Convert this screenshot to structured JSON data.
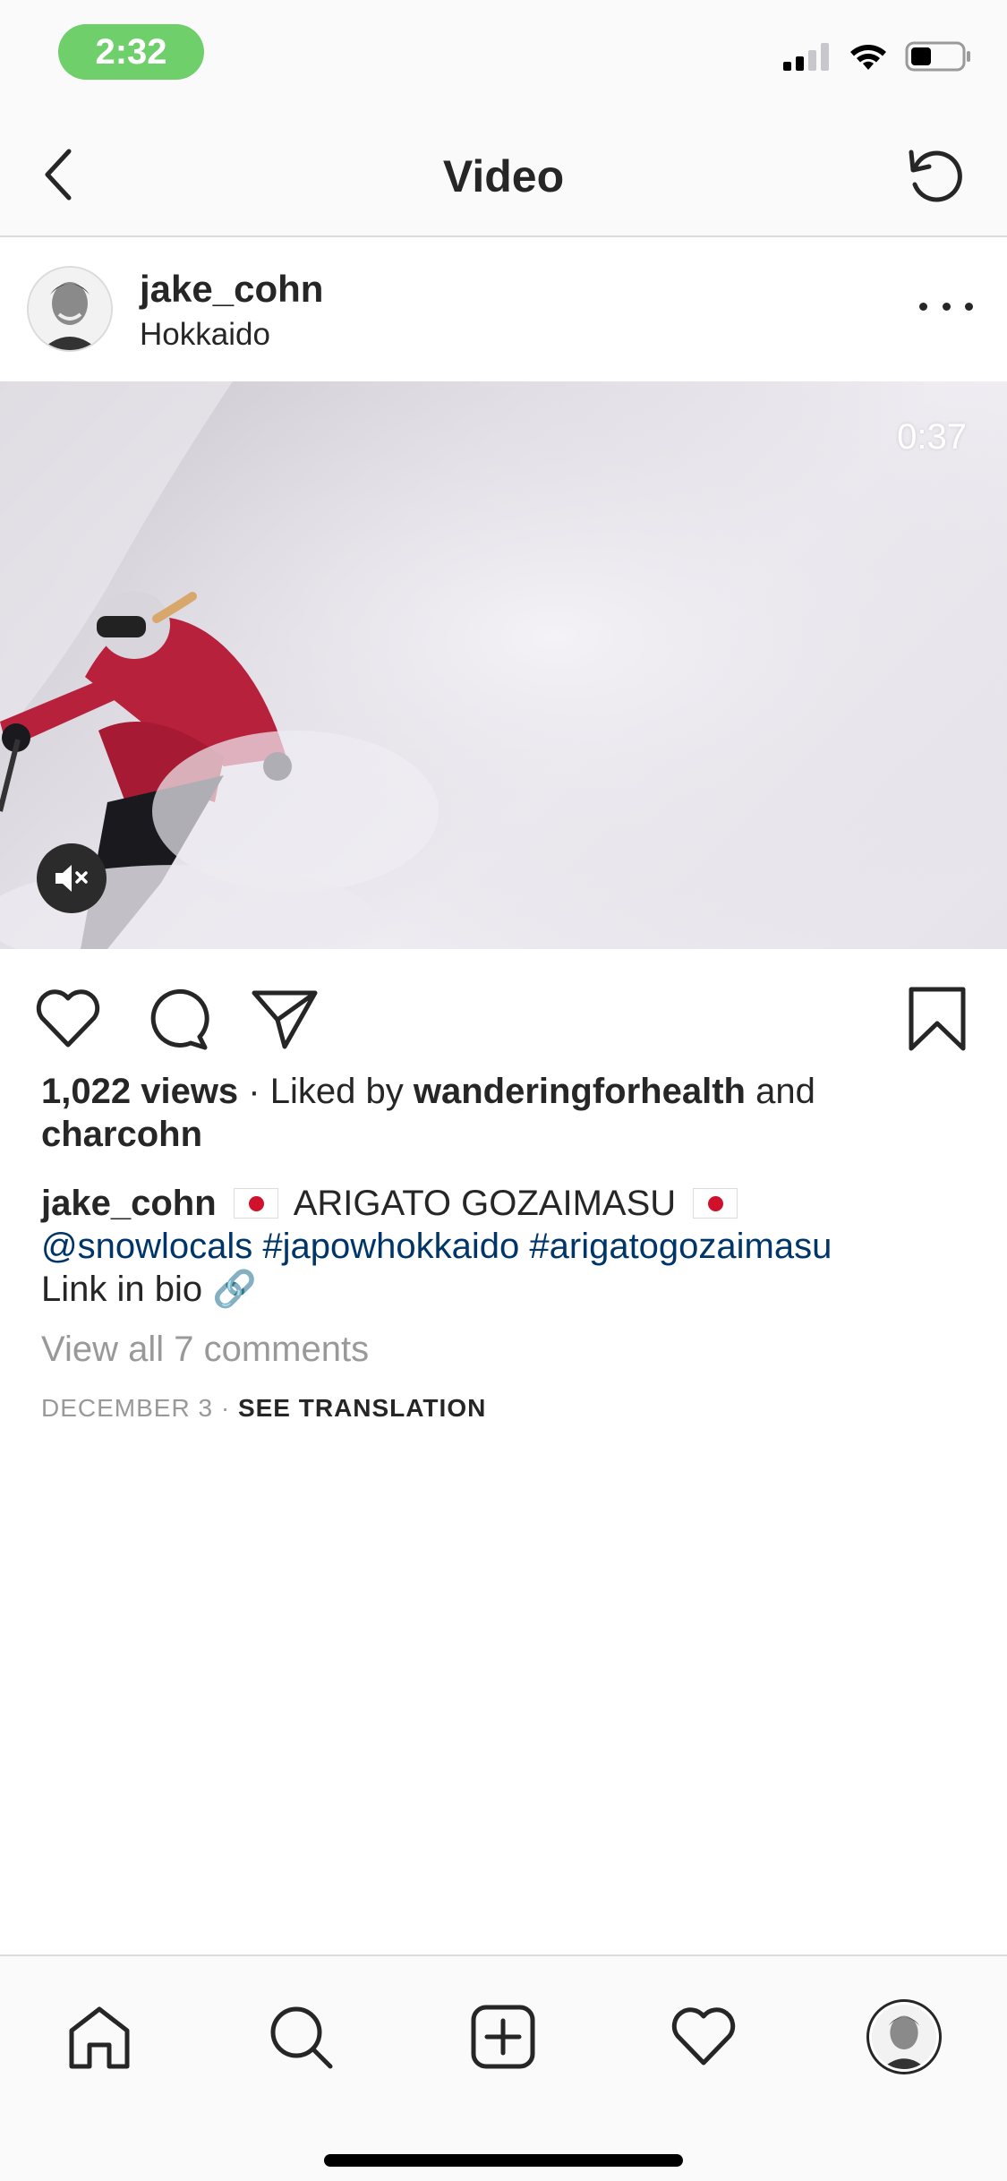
{
  "status_bar": {
    "time": "2:32"
  },
  "nav": {
    "title": "Video"
  },
  "post": {
    "username": "jake_cohn",
    "location": "Hokkaido",
    "video_duration": "0:37",
    "views": "1,022 views",
    "liked_by_prefix": " · Liked by ",
    "liked_by_user1": "wanderingforhealth",
    "liked_by_and": " and",
    "liked_by_user2": "charcohn",
    "caption_user": "jake_cohn",
    "caption_text": " ARIGATO GOZAIMASU ",
    "mention": "@snowlocals",
    "hashtag1": "#japowhokkaido",
    "hashtag2": "#arigatogozaimasu",
    "caption_line3": "Link in bio",
    "link_emoji": "🔗",
    "comments_link": "View all 7 comments",
    "date": "DECEMBER 3",
    "date_sep": " · ",
    "see_translation": "SEE TRANSLATION"
  },
  "icons": {
    "back": "chevron-left-icon",
    "reload": "refresh-icon",
    "more": "more-horizontal-icon",
    "mute": "speaker-muted-icon",
    "like": "heart-icon",
    "comment": "comment-bubble-icon",
    "share": "paper-plane-icon",
    "save": "bookmark-icon",
    "home": "home-icon",
    "search": "search-icon",
    "add": "plus-square-icon",
    "activity": "heart-icon",
    "profile": "avatar"
  },
  "colors": {
    "time_pill": "#6fcf6b",
    "link": "#003569",
    "muted_text": "#999999",
    "primary_text": "#262626",
    "flag_red": "#d0112b"
  }
}
